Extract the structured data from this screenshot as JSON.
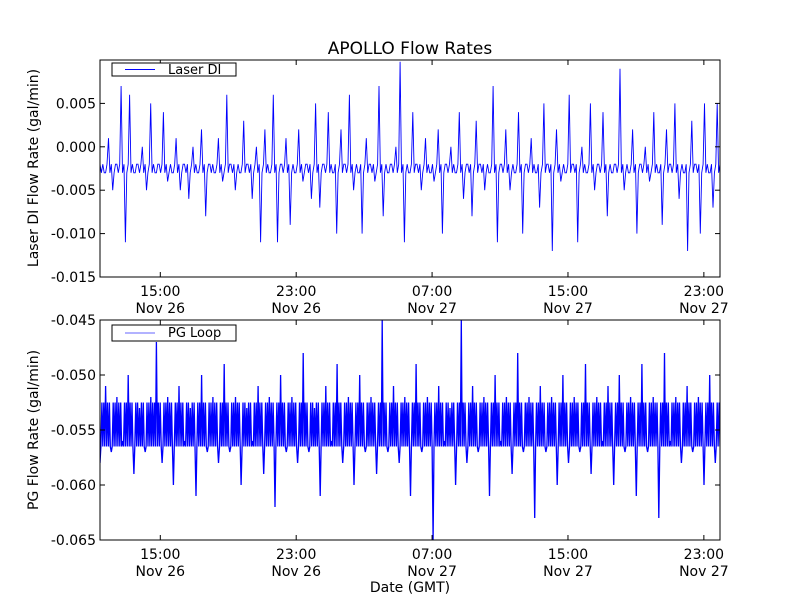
{
  "chart_data": [
    {
      "type": "line",
      "title": "APOLLO Flow Rates",
      "ylabel": "Laser DI Flow Rate (gal/min)",
      "xlabel": "",
      "legend": {
        "label": "Laser DI",
        "placement": "top-left"
      },
      "color": "#0000ff",
      "x_unit": "hours since Nov 26 00:00 GMT",
      "xlim": [
        11.45,
        47.95
      ],
      "ylim": [
        -0.015,
        0.01
      ],
      "yticks": [
        0.005,
        0.0,
        -0.005,
        -0.01,
        -0.015
      ],
      "ytick_labels": [
        "0.005",
        "0.000",
        "-0.005",
        "-0.010",
        "-0.015"
      ],
      "xticks": [
        15,
        23,
        31,
        39,
        47
      ],
      "xtick_labels": [
        [
          "15:00",
          "Nov 26"
        ],
        [
          "23:00",
          "Nov 26"
        ],
        [
          "07:00",
          "Nov 27"
        ],
        [
          "15:00",
          "Nov 27"
        ],
        [
          "23:00",
          "Nov 27"
        ]
      ],
      "values": [
        -0.002,
        -0.003,
        0.001,
        -0.005,
        -0.002,
        0.007,
        -0.011,
        0.006,
        -0.003,
        -0.002,
        0.0,
        -0.005,
        0.005,
        -0.003,
        -0.002,
        0.004,
        -0.004,
        -0.003,
        0.001,
        -0.005,
        -0.002,
        -0.006,
        0.0,
        -0.003,
        0.002,
        -0.008,
        -0.002,
        -0.003,
        0.001,
        -0.004,
        0.006,
        -0.002,
        -0.005,
        -0.003,
        0.003,
        -0.002,
        -0.006,
        0.0,
        -0.011,
        0.002,
        -0.003,
        0.006,
        -0.011,
        -0.002,
        0.001,
        -0.009,
        -0.003,
        0.002,
        -0.004,
        -0.002,
        -0.006,
        0.005,
        -0.007,
        -0.002,
        0.004,
        -0.003,
        -0.01,
        0.002,
        -0.002,
        0.006,
        -0.005,
        -0.003,
        -0.01,
        0.001,
        -0.002,
        -0.004,
        0.007,
        -0.008,
        -0.003,
        -0.002,
        0.0,
        0.0098,
        -0.011,
        -0.003,
        0.004,
        -0.002,
        -0.005,
        0.001,
        -0.003,
        -0.004,
        0.002,
        -0.01,
        -0.002,
        0.0,
        -0.003,
        0.004,
        -0.006,
        -0.002,
        -0.008,
        0.003,
        -0.002,
        -0.005,
        -0.003,
        0.007,
        -0.011,
        -0.002,
        0.002,
        -0.005,
        -0.003,
        0.004,
        -0.01,
        -0.002,
        0.001,
        -0.003,
        -0.007,
        0.005,
        -0.002,
        -0.012,
        0.002,
        -0.004,
        -0.003,
        0.006,
        -0.002,
        -0.011,
        0.0,
        -0.003,
        0.005,
        -0.005,
        -0.002,
        0.004,
        -0.008,
        -0.003,
        -0.002,
        0.009,
        -0.005,
        -0.003,
        0.002,
        -0.01,
        -0.002,
        0.0,
        -0.004,
        0.004,
        -0.003,
        -0.009,
        0.002,
        -0.002,
        0.005,
        -0.006,
        -0.003,
        -0.012,
        0.003,
        -0.002,
        -0.01,
        0.005,
        -0.003,
        -0.007,
        0.005
      ]
    },
    {
      "type": "line",
      "title": "",
      "ylabel": "PG Flow Rate (gal/min)",
      "xlabel": "Date (GMT)",
      "legend": {
        "label": "PG Loop",
        "placement": "top-left"
      },
      "color": "#0000ff",
      "x_unit": "hours since Nov 26 00:00 GMT",
      "xlim": [
        11.45,
        47.95
      ],
      "ylim": [
        -0.065,
        -0.045
      ],
      "yticks": [
        -0.045,
        -0.05,
        -0.055,
        -0.06,
        -0.065
      ],
      "ytick_labels": [
        "-0.045",
        "-0.050",
        "-0.055",
        "-0.060",
        "-0.065"
      ],
      "xticks": [
        15,
        23,
        31,
        39,
        47
      ],
      "xtick_labels": [
        [
          "15:00",
          "Nov 26"
        ],
        [
          "23:00",
          "Nov 26"
        ],
        [
          "07:00",
          "Nov 27"
        ],
        [
          "15:00",
          "Nov 27"
        ],
        [
          "23:00",
          "Nov 27"
        ]
      ],
      "values": [
        -0.058,
        -0.051,
        -0.057,
        -0.052,
        -0.056,
        -0.05,
        -0.059,
        -0.053,
        -0.057,
        -0.052,
        -0.047,
        -0.058,
        -0.052,
        -0.06,
        -0.051,
        -0.056,
        -0.053,
        -0.061,
        -0.05,
        -0.057,
        -0.052,
        -0.058,
        -0.049,
        -0.057,
        -0.052,
        -0.06,
        -0.053,
        -0.056,
        -0.051,
        -0.059,
        -0.052,
        -0.062,
        -0.05,
        -0.057,
        -0.052,
        -0.058,
        -0.048,
        -0.057,
        -0.053,
        -0.061,
        -0.051,
        -0.056,
        -0.049,
        -0.058,
        -0.052,
        -0.06,
        -0.05,
        -0.057,
        -0.052,
        -0.059,
        -0.045,
        -0.057,
        -0.051,
        -0.058,
        -0.052,
        -0.061,
        -0.049,
        -0.057,
        -0.052,
        -0.065,
        -0.051,
        -0.056,
        -0.053,
        -0.06,
        -0.045,
        -0.058,
        -0.051,
        -0.057,
        -0.052,
        -0.061,
        -0.05,
        -0.056,
        -0.052,
        -0.059,
        -0.048,
        -0.057,
        -0.052,
        -0.063,
        -0.051,
        -0.057,
        -0.052,
        -0.06,
        -0.05,
        -0.058,
        -0.052,
        -0.057,
        -0.049,
        -0.059,
        -0.052,
        -0.056,
        -0.051,
        -0.06,
        -0.05,
        -0.057,
        -0.052,
        -0.061,
        -0.049,
        -0.057,
        -0.052,
        -0.063,
        -0.048,
        -0.056,
        -0.052,
        -0.058,
        -0.051,
        -0.057,
        -0.052,
        -0.06,
        -0.05,
        -0.058
      ]
    }
  ]
}
